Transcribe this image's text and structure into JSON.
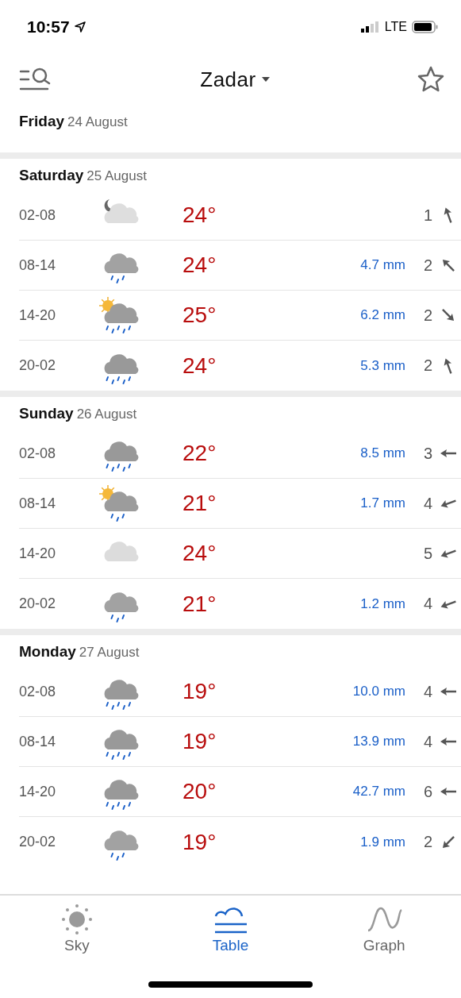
{
  "status_bar": {
    "time": "10:57",
    "network": "LTE"
  },
  "header": {
    "city": "Zadar"
  },
  "days": [
    {
      "weekday": "Friday",
      "date": "24 August"
    },
    {
      "weekday": "Saturday",
      "date": "25 August",
      "rows": [
        {
          "period": "02-08",
          "kind": "moon-cloud",
          "temp": "24°",
          "wind": {
            "speed": "1",
            "kind": "NNW"
          }
        },
        {
          "period": "08-14",
          "kind": "light-rain",
          "temp": "24°",
          "precip": "4.7 mm",
          "wind": {
            "speed": "2",
            "kind": "NW"
          }
        },
        {
          "period": "14-20",
          "kind": "sun-rain",
          "temp": "25°",
          "precip": "6.2 mm",
          "wind": {
            "speed": "2",
            "kind": "SE"
          }
        },
        {
          "period": "20-02",
          "kind": "rain",
          "temp": "24°",
          "precip": "5.3 mm",
          "wind": {
            "speed": "2",
            "kind": "NNW"
          }
        }
      ]
    },
    {
      "weekday": "Sunday",
      "date": "26 August",
      "rows": [
        {
          "period": "02-08",
          "kind": "rain",
          "temp": "22°",
          "precip": "8.5 mm",
          "wind": {
            "speed": "3",
            "kind": "W"
          }
        },
        {
          "period": "08-14",
          "kind": "sun-light-rain",
          "temp": "21°",
          "precip": "1.7 mm",
          "wind": {
            "speed": "4",
            "kind": "WSW"
          }
        },
        {
          "period": "14-20",
          "kind": "cloud",
          "temp": "24°",
          "wind": {
            "speed": "5",
            "kind": "WSW"
          }
        },
        {
          "period": "20-02",
          "kind": "light-rain",
          "temp": "21°",
          "precip": "1.2 mm",
          "wind": {
            "speed": "4",
            "kind": "WSW"
          }
        }
      ]
    },
    {
      "weekday": "Monday",
      "date": "27 August",
      "rows": [
        {
          "period": "02-08",
          "kind": "rain",
          "temp": "19°",
          "precip": "10.0 mm",
          "wind": {
            "speed": "4",
            "kind": "W"
          }
        },
        {
          "period": "08-14",
          "kind": "rain",
          "temp": "19°",
          "precip": "13.9 mm",
          "wind": {
            "speed": "4",
            "kind": "W"
          }
        },
        {
          "period": "14-20",
          "kind": "rain",
          "temp": "20°",
          "precip": "42.7 mm",
          "wind": {
            "speed": "6",
            "kind": "W"
          }
        },
        {
          "period": "20-02",
          "kind": "light-rain",
          "temp": "19°",
          "precip": "1.9 mm",
          "wind": {
            "speed": "2",
            "kind": "SW"
          }
        }
      ]
    }
  ],
  "tabs": [
    {
      "label": "Sky",
      "kind": "sky",
      "selected": false
    },
    {
      "label": "Table",
      "kind": "table",
      "selected": true
    },
    {
      "label": "Graph",
      "kind": "graph",
      "selected": false
    }
  ]
}
